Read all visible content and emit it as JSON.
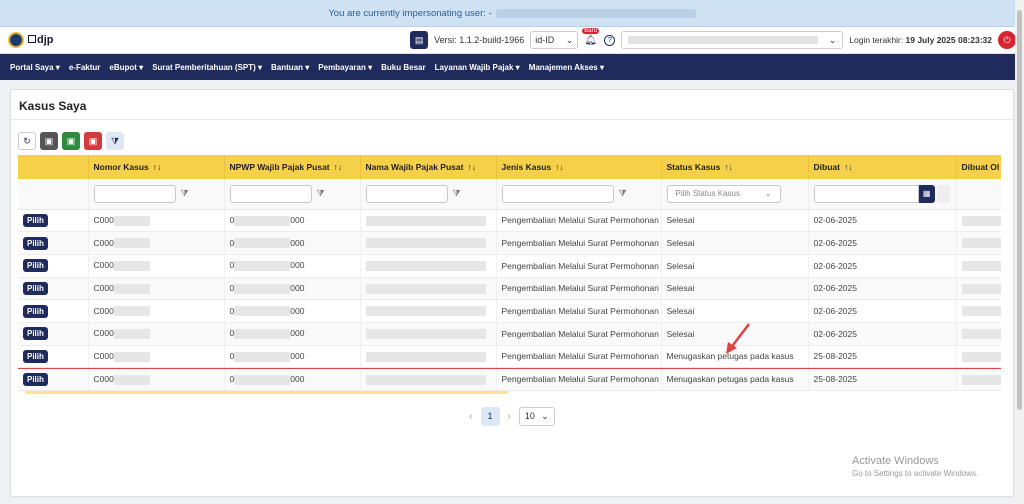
{
  "banner": {
    "text": "You are currently impersonating user: -"
  },
  "topbar": {
    "logo_text": "djp",
    "version_label": "Versi:",
    "version_value": "1.1.2-build-1966",
    "language": "id-ID",
    "notif_badge": "Baru",
    "login_label": "Login terakhir:",
    "login_value": "19 July 2025 08:23:32"
  },
  "nav": {
    "items": [
      {
        "label": "Portal Saya",
        "caret": true
      },
      {
        "label": "e-Faktur",
        "caret": false
      },
      {
        "label": "eBupot",
        "caret": true
      },
      {
        "label": "Surat Pemberitahuan (SPT)",
        "caret": true
      },
      {
        "label": "Bantuan",
        "caret": true
      },
      {
        "label": "Pembayaran",
        "caret": true
      },
      {
        "label": "Buku Besar",
        "caret": false
      },
      {
        "label": "Layanan Wajib Pajak",
        "caret": true
      },
      {
        "label": "Manajemen Akses",
        "caret": true
      }
    ]
  },
  "page": {
    "title": "Kasus Saya"
  },
  "table": {
    "columns": [
      "Nomor Kasus",
      "NPWP Wajib Pajak Pusat",
      "Nama Wajib Pajak Pusat",
      "Jenis Kasus",
      "Status Kasus",
      "Dibuat",
      "Dibuat Ol"
    ],
    "sort_icon": "↑↓",
    "status_filter_placeholder": "Pilih Status Kasus",
    "action_label": "Pilih",
    "rows": [
      {
        "nomor": "C000",
        "npwp_prefix": "0",
        "npwp_suffix": "000",
        "jenis": "Pengembalian Melalui Surat Permohonan",
        "status": "Selesai",
        "dibuat": "02-06-2025"
      },
      {
        "nomor": "C000",
        "npwp_prefix": "0",
        "npwp_suffix": "000",
        "jenis": "Pengembalian Melalui Surat Permohonan",
        "status": "Selesai",
        "dibuat": "02-06-2025"
      },
      {
        "nomor": "C000",
        "npwp_prefix": "0",
        "npwp_suffix": "000",
        "jenis": "Pengembalian Melalui Surat Permohonan",
        "status": "Selesai",
        "dibuat": "02-06-2025"
      },
      {
        "nomor": "C000",
        "npwp_prefix": "0",
        "npwp_suffix": "000",
        "jenis": "Pengembalian Melalui Surat Permohonan",
        "status": "Selesai",
        "dibuat": "02-06-2025"
      },
      {
        "nomor": "C000",
        "npwp_prefix": "0",
        "npwp_suffix": "000",
        "jenis": "Pengembalian Melalui Surat Permohonan",
        "status": "Selesai",
        "dibuat": "02-06-2025"
      },
      {
        "nomor": "C000",
        "npwp_prefix": "0",
        "npwp_suffix": "000",
        "jenis": "Pengembalian Melalui Surat Permohonan",
        "status": "Selesai",
        "dibuat": "02-06-2025"
      },
      {
        "nomor": "C000",
        "npwp_prefix": "0",
        "npwp_suffix": "000",
        "jenis": "Pengembalian Melalui Surat Permohonan",
        "status": "Menugaskan petugas pada kasus",
        "dibuat": "25-08-2025"
      },
      {
        "nomor": "C000",
        "npwp_prefix": "0",
        "npwp_suffix": "000",
        "jenis": "Pengembalian Melalui Surat Permohonan",
        "status": "Menugaskan petugas pada kasus",
        "dibuat": "25-08-2025"
      }
    ]
  },
  "pagination": {
    "current_page": "1",
    "page_size": "10"
  },
  "watermark": {
    "title": "Activate Windows",
    "subtitle": "Go to Settings to activate Windows."
  },
  "colors": {
    "navy": "#1f2b5c",
    "header_yellow": "#f7d04a",
    "highlight_red": "#e04343"
  }
}
